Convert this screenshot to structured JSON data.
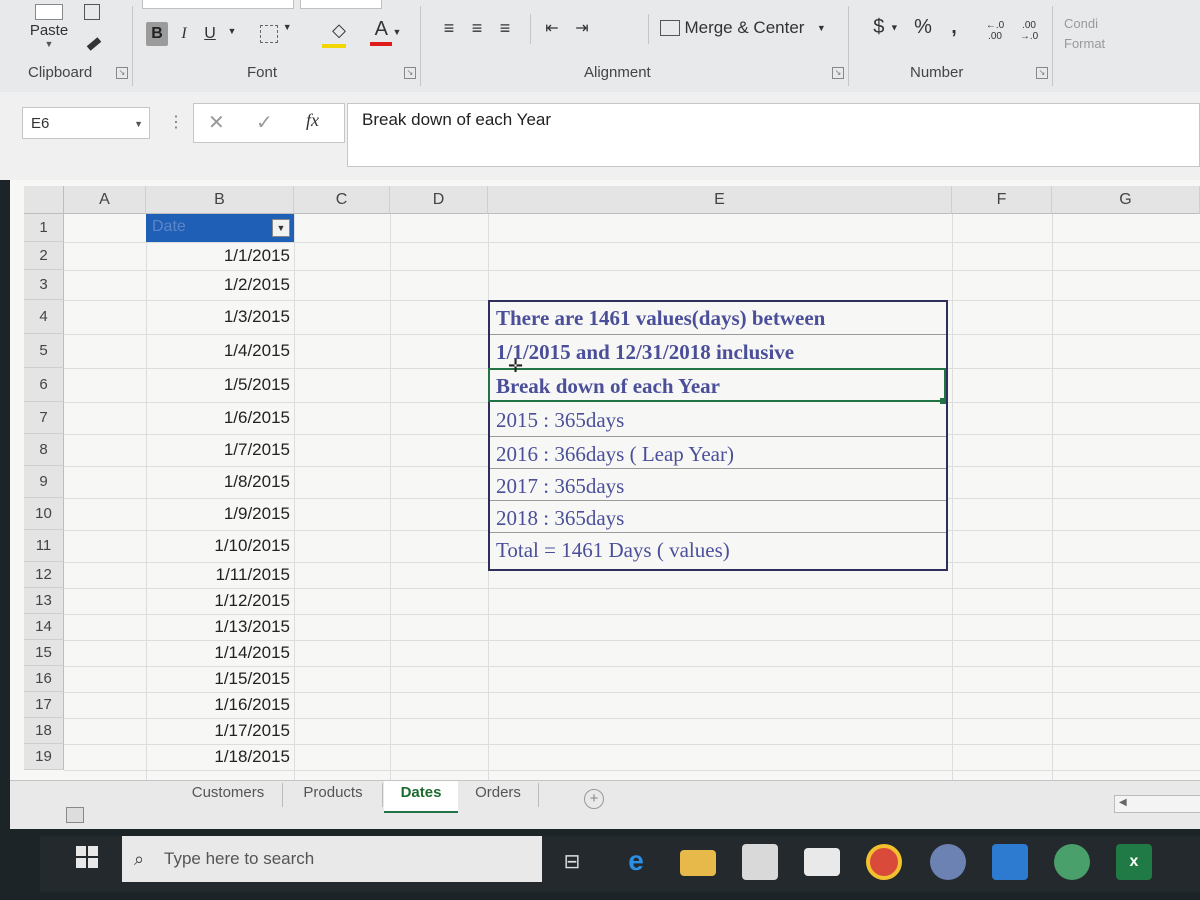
{
  "ribbon": {
    "clipboard": {
      "label": "Clipboard",
      "paste_label": "Paste"
    },
    "font": {
      "label": "Font",
      "bold": "B",
      "italic": "I",
      "underline": "U",
      "font_color": "A"
    },
    "alignment": {
      "label": "Alignment",
      "merge_center": "Merge & Center"
    },
    "number": {
      "label": "Number",
      "currency": "$",
      "percent": "%",
      "comma": ",",
      "increase_decimal": "←.0 .00",
      "decrease_decimal": ".00 →.0"
    },
    "styles": {
      "conditional_formatting": "Condi Format"
    }
  },
  "formula_bar": {
    "name_box": "E6",
    "cancel": "✕",
    "enter": "✓",
    "fx": "fx",
    "content": "Break down of each Year"
  },
  "grid": {
    "columns": [
      "A",
      "B",
      "C",
      "D",
      "E",
      "F",
      "G"
    ],
    "rows": [
      "1",
      "2",
      "3",
      "4",
      "5",
      "6",
      "7",
      "8",
      "9",
      "10",
      "11",
      "12",
      "13",
      "14",
      "15",
      "16",
      "17",
      "18",
      "19"
    ],
    "header_cell": "Date",
    "dates": [
      "1/1/2015",
      "1/2/2015",
      "1/3/2015",
      "1/4/2015",
      "1/5/2015",
      "1/6/2015",
      "1/7/2015",
      "1/8/2015",
      "1/9/2015",
      "1/10/2015",
      "1/11/2015",
      "1/12/2015",
      "1/13/2015",
      "1/14/2015",
      "1/15/2015",
      "1/16/2015",
      "1/17/2015",
      "1/18/2015"
    ]
  },
  "textbox": {
    "lines": [
      "There are 1461 values(days) between",
      "1/1/2015 and 12/31/2018 inclusive",
      "Break down of each Year",
      "2015 :  365days",
      "2016 :  366days  ( Leap Year)",
      "2017 :  365days",
      "2018 :  365days",
      "Total =   1461 Days ( values)"
    ]
  },
  "sheets": {
    "tabs": [
      "Customers",
      "Products",
      "Dates",
      "Orders"
    ],
    "active": "Dates"
  },
  "taskbar": {
    "search_placeholder": "Type here to search"
  },
  "colors": {
    "textbox_text": "#4b4f9a",
    "header_fill": "#1f5fb5",
    "active_tab": "#217346"
  }
}
